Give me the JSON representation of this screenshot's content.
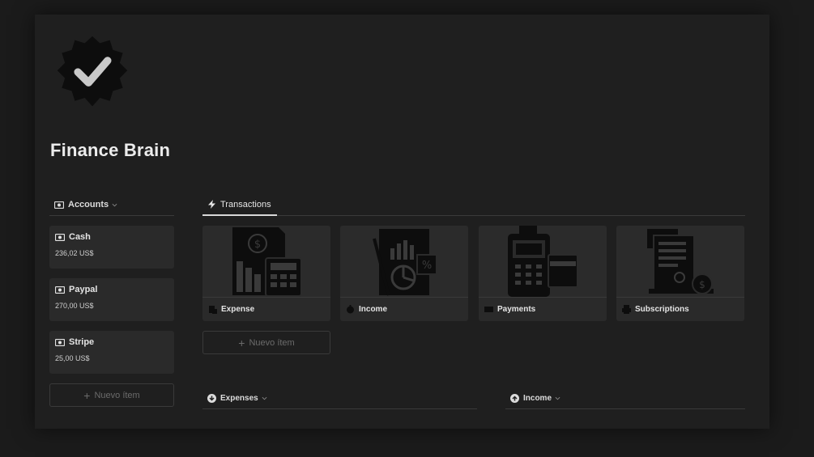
{
  "page": {
    "title": "Finance Brain",
    "icon": "verified-badge-icon"
  },
  "accounts": {
    "header": "Accounts",
    "items": [
      {
        "name": "Cash",
        "amount": "236,02 US$",
        "icon": "money-icon"
      },
      {
        "name": "Paypal",
        "amount": "270,00 US$",
        "icon": "money-icon"
      },
      {
        "name": "Stripe",
        "amount": "25,00 US$",
        "icon": "money-icon"
      }
    ],
    "new_item": "Nuevo ítem"
  },
  "transactions": {
    "tab": "Transactions",
    "cards": [
      {
        "label": "Expense",
        "icon": "expense-icon"
      },
      {
        "label": "Income",
        "icon": "income-icon"
      },
      {
        "label": "Payments",
        "icon": "card-icon"
      },
      {
        "label": "Subscriptions",
        "icon": "printer-icon"
      }
    ],
    "new_item": "Nuevo ítem"
  },
  "sections": {
    "expenses": "Expenses",
    "income": "Income"
  },
  "colors": {
    "background": "#1b1b1b",
    "page": "#1f1f1f",
    "card": "#2a2a2a",
    "border": "#3a3a3a",
    "text": "#e6e6e6",
    "muted": "#6b6b6b"
  }
}
